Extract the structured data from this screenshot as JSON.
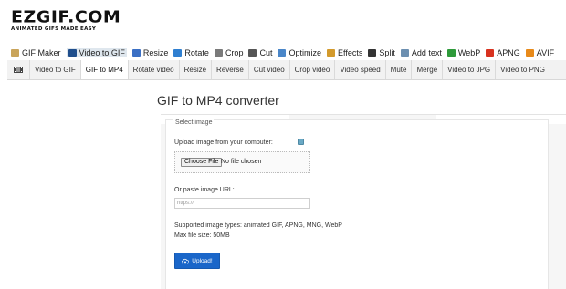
{
  "logo": {
    "main": "EZGIF.COM",
    "tagline": "ANIMATED GIFS MADE EASY"
  },
  "main_nav": [
    {
      "label": "GIF Maker",
      "icon": "gif-maker-icon",
      "color": "#c9a45a"
    },
    {
      "label": "Video to GIF",
      "icon": "video-to-gif-icon",
      "color": "#1f4e8c",
      "active": true
    },
    {
      "label": "Resize",
      "icon": "resize-icon",
      "color": "#3a6fc4"
    },
    {
      "label": "Rotate",
      "icon": "rotate-icon",
      "color": "#2f7fd0"
    },
    {
      "label": "Crop",
      "icon": "crop-icon",
      "color": "#7a7a7a"
    },
    {
      "label": "Cut",
      "icon": "cut-icon",
      "color": "#555555"
    },
    {
      "label": "Optimize",
      "icon": "optimize-icon",
      "color": "#4a86c8"
    },
    {
      "label": "Effects",
      "icon": "effects-icon",
      "color": "#d39a2c"
    },
    {
      "label": "Split",
      "icon": "split-icon",
      "color": "#333333"
    },
    {
      "label": "Add text",
      "icon": "add-text-icon",
      "color": "#6c8fb0"
    },
    {
      "label": "WebP",
      "icon": "webp-icon",
      "color": "#2e9a3a"
    },
    {
      "label": "APNG",
      "icon": "apng-icon",
      "color": "#d8321f"
    },
    {
      "label": "AVIF",
      "icon": "avif-icon",
      "color": "#e88a1a"
    }
  ],
  "sub_nav": [
    {
      "label": "Video to GIF"
    },
    {
      "label": "GIF to MP4",
      "active": true
    },
    {
      "label": "Rotate video"
    },
    {
      "label": "Resize"
    },
    {
      "label": "Reverse"
    },
    {
      "label": "Cut video"
    },
    {
      "label": "Crop video"
    },
    {
      "label": "Video speed"
    },
    {
      "label": "Mute"
    },
    {
      "label": "Merge"
    },
    {
      "label": "Video to JPG"
    },
    {
      "label": "Video to PNG"
    }
  ],
  "page_title": "GIF to MP4 converter",
  "form": {
    "legend": "Select image",
    "upload_label": "Upload image from your computer:",
    "choose_file_label": "Choose File",
    "file_status": "No file chosen",
    "url_label": "Or paste image URL:",
    "url_placeholder": "https://",
    "supported_types": "Supported image types: animated GIF, APNG, MNG, WebP",
    "max_size": "Max file size: 50MB",
    "upload_button": "Upload!"
  },
  "colors": {
    "accent": "#1a66c9",
    "subnav_bg": "#f2f2f2",
    "active_main_bg": "#dfe7ee"
  }
}
